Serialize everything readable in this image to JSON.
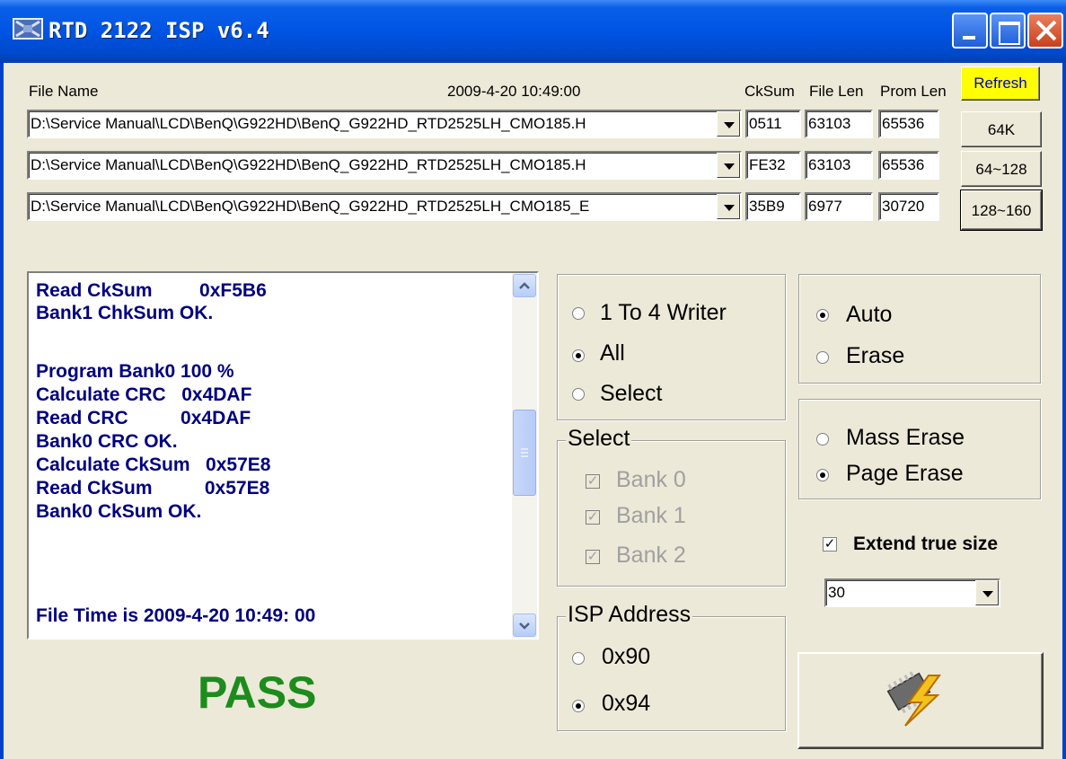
{
  "window": {
    "title": "RTD 2122 ISP v6.4"
  },
  "header": {
    "file_name_label": "File Name",
    "file_time": "2009-4-20 10:49:00",
    "cksum_label": "CkSum",
    "file_len_label": "File Len",
    "prom_len_label": "Prom Len",
    "refresh_label": "Refresh"
  },
  "files": [
    {
      "path": "D:\\Service Manual\\LCD\\BenQ\\G922HD\\BenQ_G922HD_RTD2525LH_CMO185.H",
      "cksum": "0511",
      "file_len": "63103",
      "prom_len": "65536",
      "button": "64K"
    },
    {
      "path": "D:\\Service Manual\\LCD\\BenQ\\G922HD\\BenQ_G922HD_RTD2525LH_CMO185.H",
      "cksum": "FE32",
      "file_len": "63103",
      "prom_len": "65536",
      "button": "64~128"
    },
    {
      "path": "D:\\Service Manual\\LCD\\BenQ\\G922HD\\BenQ_G922HD_RTD2525LH_CMO185_E",
      "cksum": "35B9",
      "file_len": "6977",
      "prom_len": "30720",
      "button": "128~160"
    }
  ],
  "log": {
    "lines": [
      "Read CkSum         0xF5B6",
      "Bank1 ChkSum OK.",
      "",
      "Program Bank0 100 %",
      "Calculate CRC   0x4DAF",
      "Read CRC          0x4DAF",
      "Bank0 CRC OK.",
      "Calculate CkSum   0x57E8",
      "Read CkSum          0x57E8",
      "Bank0 CkSum OK.",
      "",
      "",
      "File Time is 2009-4-20 10:49: 00"
    ]
  },
  "status": {
    "result": "PASS",
    "result_color": "#1c8c1c"
  },
  "writer_group": {
    "options": [
      "1 To 4 Writer",
      "All",
      "Select"
    ],
    "selected": "All"
  },
  "select_group": {
    "legend": "Select",
    "banks": [
      "Bank 0",
      "Bank 1",
      "Bank 2"
    ],
    "checked_disabled": true
  },
  "isp_group": {
    "legend": "ISP Address",
    "options": [
      "0x90",
      "0x94"
    ],
    "selected": "0x94"
  },
  "mode_group": {
    "options": [
      "Auto",
      "Erase"
    ],
    "selected": "Auto"
  },
  "erase_group": {
    "options": [
      "Mass Erase",
      "Page Erase"
    ],
    "selected": "Page Erase"
  },
  "extend": {
    "label": "Extend true size",
    "checked": true,
    "value": "30"
  },
  "icons": {
    "title_icon": "app-icon",
    "flash_icon": "lightning-chip-icon"
  }
}
